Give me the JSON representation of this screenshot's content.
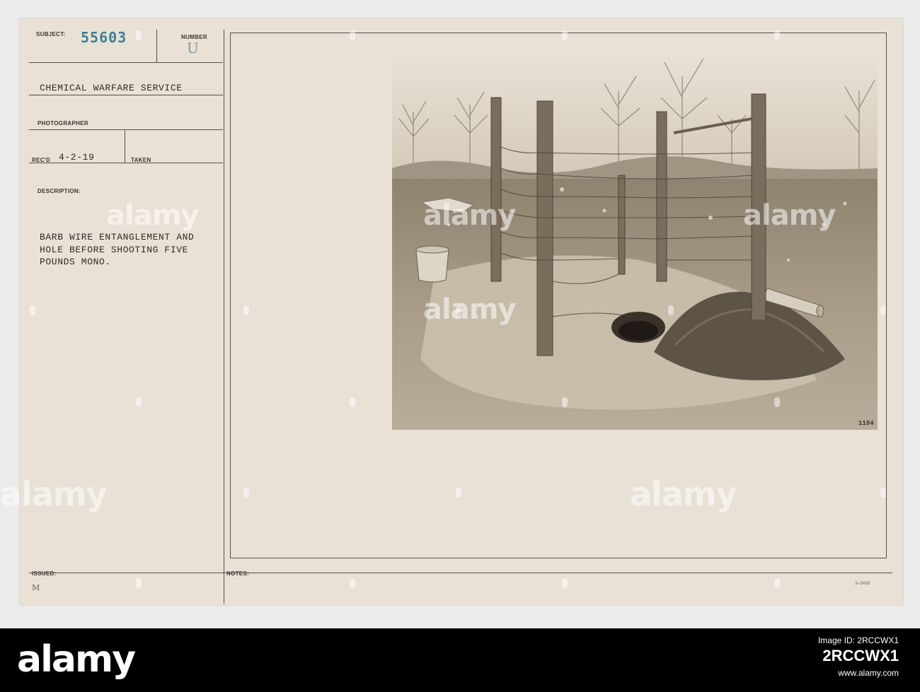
{
  "card": {
    "subject_label": "SUBJECT:",
    "subject_number": "55603",
    "number_label": "NUMBER",
    "number_stamp": "U",
    "organization": "CHEMICAL WARFARE SERVICE",
    "photographer_label": "PHOTOGRAPHER",
    "recd_label": "REC'D",
    "recd_date": "4-2-19",
    "taken_label": "TAKEN",
    "description_label": "DESCRIPTION:",
    "description_lines": [
      "BARB WIRE ENTANGLEMENT AND",
      "HOLE BEFORE SHOOTING FIVE",
      "POUNDS MONO."
    ],
    "issued_label": "ISSUED:",
    "issued_mark": "M",
    "notes_label": "NOTES:",
    "form_code": "3—5605"
  },
  "photo": {
    "print_number": "1184"
  },
  "watermark": {
    "text": "alamy"
  },
  "footer": {
    "logo": "alamy",
    "image_id_label": "Image ID: 2RCCWX1",
    "image_id_code": "2RCCWX1",
    "url": "www.alamy.com"
  }
}
